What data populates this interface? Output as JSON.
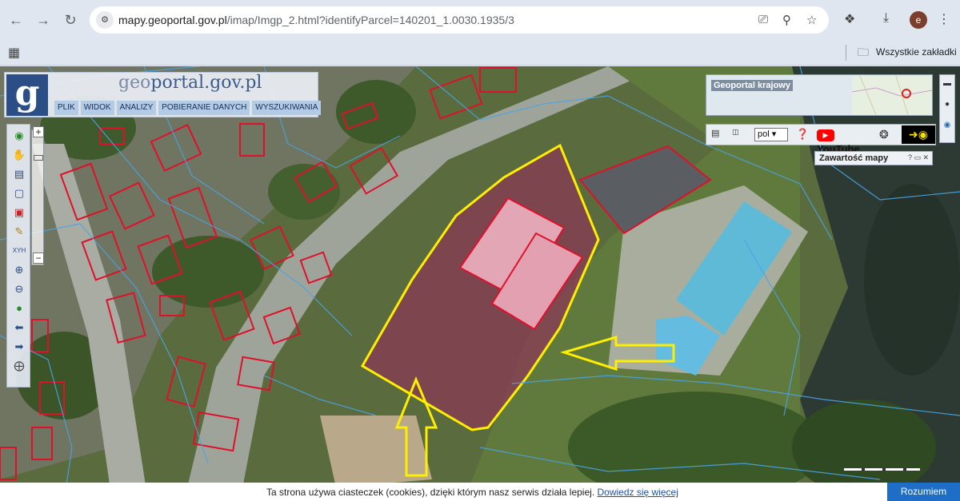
{
  "browser": {
    "url_host": "mapy.geoportal.gov.pl",
    "url_path": "/imap/Imgp_2.html?identifyParcel=140201_1.0030.1935/3",
    "bookmarks_label": "Wszystkie zakładki",
    "avatar_letter": "e"
  },
  "geoportal": {
    "logo_letter": "g",
    "title_prefix": "geo",
    "title_rest": "portal.gov.pl",
    "menu": [
      "PLIK",
      "WIDOK",
      "ANALIZY",
      "POBIERANIE DANYCH",
      "WYSZUKIWANIA"
    ],
    "overview_label": "Geoportal krajowy",
    "language": "pol",
    "youtube_label": "YouTube",
    "content_panel_title": "Zawartość mapy"
  },
  "cookie": {
    "text": "Ta strona używa ciasteczek (cookies), dzięki którym nasz serwis działa lepiej.",
    "link": "Dowiedz się więcej",
    "button": "Rozumiem"
  },
  "colors": {
    "parcel_outline": "#ffee00",
    "building_outline": "#e0102a",
    "parcel_lines": "#4aa3e6",
    "geoportal_blue": "#2b4e86"
  },
  "icons": {
    "back": "arrow-left-icon",
    "forward": "arrow-right-icon",
    "reload": "reload-icon",
    "site_info": "tune-icon",
    "install": "install-app-icon",
    "zoom": "magnifier-icon",
    "star": "star-icon",
    "extensions": "puzzle-icon",
    "download": "download-icon",
    "apps": "grid-icon",
    "folder": "folder-icon"
  }
}
